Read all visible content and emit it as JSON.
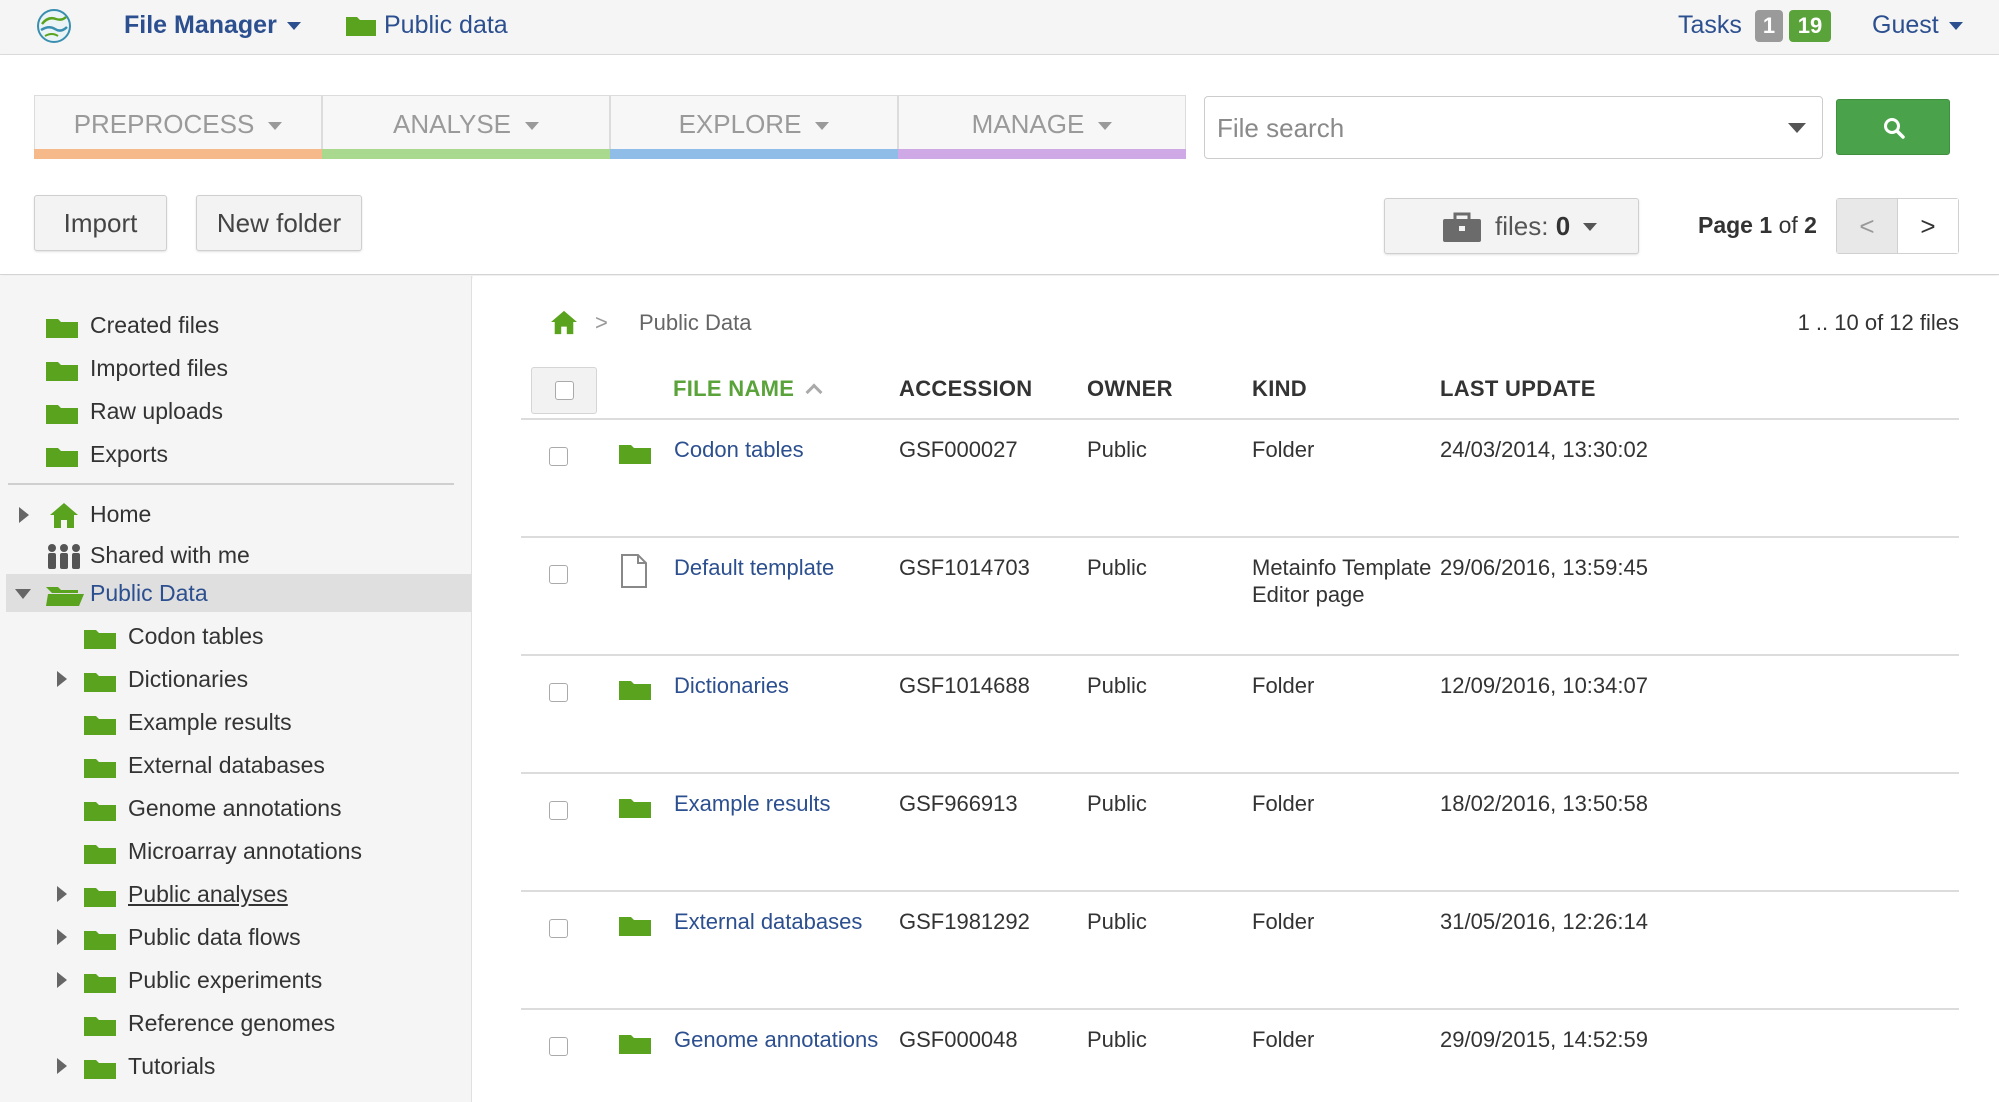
{
  "header": {
    "app_title": "File Manager",
    "breadcrumb": "Public data",
    "tasks_label": "Tasks",
    "tasks_running": "1",
    "tasks_done": "19",
    "user_label": "Guest"
  },
  "toolbar": {
    "menus": [
      {
        "label": "PREPROCESS",
        "color": "#f5b98a"
      },
      {
        "label": "ANALYSE",
        "color": "#a8d98f"
      },
      {
        "label": "EXPLORE",
        "color": "#8fbde8"
      },
      {
        "label": "MANAGE",
        "color": "#cfa8e6"
      }
    ],
    "search_placeholder": "File search",
    "import_label": "Import",
    "new_folder_label": "New folder",
    "files_label": "files:",
    "files_count": "0",
    "page_word": "Page",
    "page_current": "1",
    "page_of": "of",
    "page_total": "2",
    "prev_label": "<",
    "next_label": ">"
  },
  "sidebar": {
    "quick": [
      "Created files",
      "Imported files",
      "Raw uploads",
      "Exports"
    ],
    "home": "Home",
    "shared": "Shared with me",
    "public_data": "Public Data",
    "children": [
      "Codon tables",
      "Dictionaries",
      "Example results",
      "External databases",
      "Genome annotations",
      "Microarray annotations",
      "Public analyses",
      "Public data flows",
      "Public experiments",
      "Reference genomes",
      "Tutorials"
    ]
  },
  "main": {
    "breadcrumb_sep": ">",
    "breadcrumb": "Public Data",
    "count": "1 .. 10 of 12 files",
    "columns": [
      "FILE NAME",
      "ACCESSION",
      "OWNER",
      "KIND",
      "LAST UPDATE"
    ],
    "rows": [
      {
        "name": "Codon tables",
        "accession": "GSF000027",
        "owner": "Public",
        "kind": "Folder",
        "updated": "24/03/2014, 13:30:02",
        "icon": "folder-icon"
      },
      {
        "name": "Default template",
        "accession": "GSF1014703",
        "owner": "Public",
        "kind": "Metainfo Template Editor page",
        "updated": "29/06/2016, 13:59:45",
        "icon": "document-icon"
      },
      {
        "name": "Dictionaries",
        "accession": "GSF1014688",
        "owner": "Public",
        "kind": "Folder",
        "updated": "12/09/2016, 10:34:07",
        "icon": "folder-icon"
      },
      {
        "name": "Example results",
        "accession": "GSF966913",
        "owner": "Public",
        "kind": "Folder",
        "updated": "18/02/2016, 13:50:58",
        "icon": "folder-icon"
      },
      {
        "name": "External databases",
        "accession": "GSF1981292",
        "owner": "Public",
        "kind": "Folder",
        "updated": "31/05/2016, 12:26:14",
        "icon": "folder-icon"
      },
      {
        "name": "Genome annotations",
        "accession": "GSF000048",
        "owner": "Public",
        "kind": "Folder",
        "updated": "29/09/2015, 14:52:59",
        "icon": "folder-icon"
      }
    ]
  },
  "colors": {
    "link": "#2c4f8f",
    "folder": "#5aa31e",
    "accent_green": "#4aa34a"
  }
}
